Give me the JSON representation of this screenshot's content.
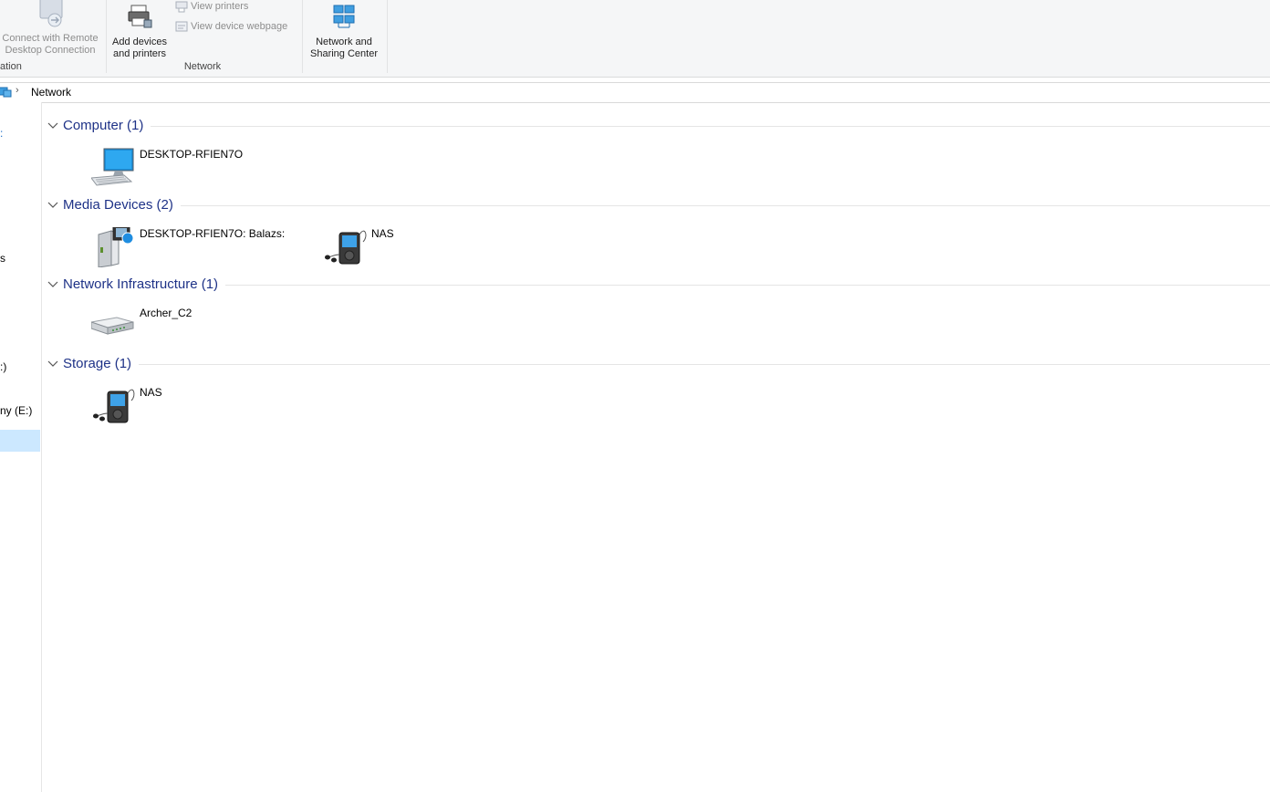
{
  "ribbon": {
    "remote": {
      "line1": "Connect with Remote",
      "line2": "Desktop Connection",
      "group": "ation"
    },
    "add_devices": {
      "line1": "Add devices",
      "line2": "and printers"
    },
    "view_printers": "View printers",
    "view_webpage": "View device webpage",
    "network_group": "Network",
    "sharing": {
      "line1": "Network and",
      "line2": "Sharing Center"
    }
  },
  "address": {
    "path": "Network"
  },
  "nav": {
    "fragments": [
      ":",
      "s",
      ":)",
      "ny (E:)"
    ]
  },
  "groups": [
    {
      "title": "Computer (1)",
      "items": [
        {
          "label": "DESKTOP-RFIEN7O",
          "icon": "computer-icon"
        }
      ]
    },
    {
      "title": "Media Devices (2)",
      "items": [
        {
          "label": "DESKTOP-RFIEN7O: Balazs:",
          "icon": "media-server-icon"
        },
        {
          "label": "NAS",
          "icon": "media-player-icon"
        }
      ]
    },
    {
      "title": "Network Infrastructure (1)",
      "items": [
        {
          "label": "Archer_C2",
          "icon": "router-icon"
        }
      ]
    },
    {
      "title": "Storage (1)",
      "items": [
        {
          "label": "NAS",
          "icon": "media-player-icon"
        }
      ]
    }
  ],
  "colors": {
    "accent": "#1e3287",
    "selection": "#cce8ff"
  }
}
